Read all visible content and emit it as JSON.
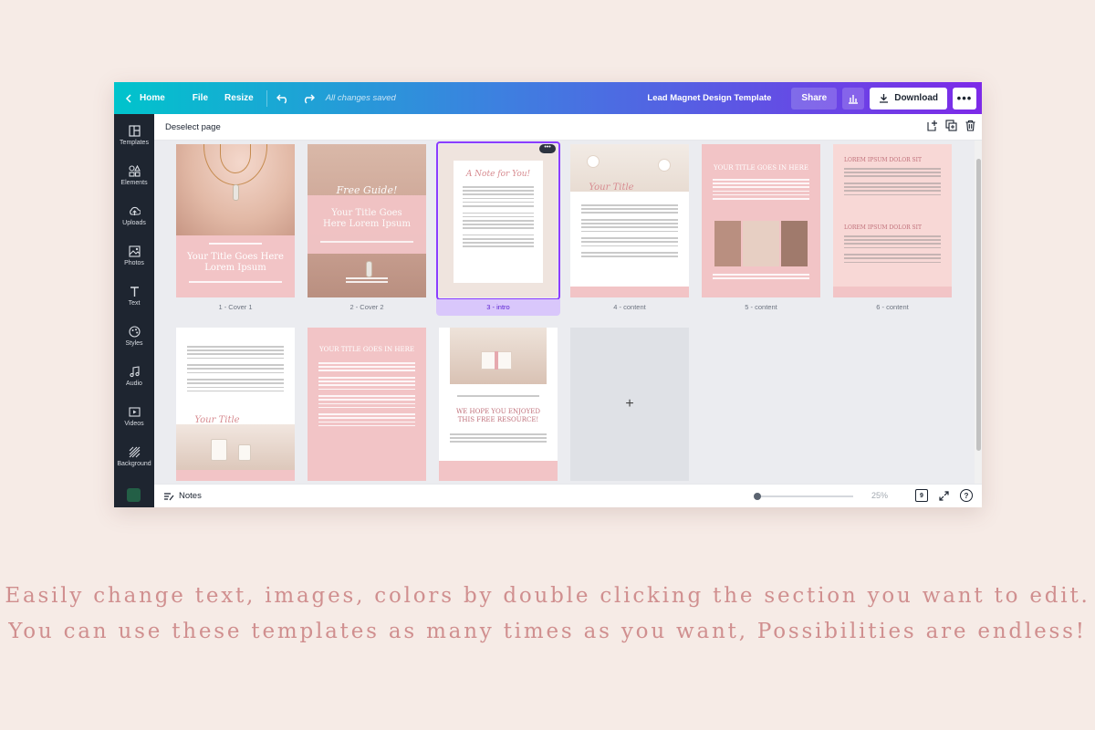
{
  "topbar": {
    "home": "Home",
    "file": "File",
    "resize": "Resize",
    "saved_status": "All changes saved",
    "doc_title": "Lead Magnet Design Template",
    "share": "Share",
    "download": "Download"
  },
  "sidebar": {
    "items": [
      {
        "label": "Templates",
        "icon": "templates-icon"
      },
      {
        "label": "Elements",
        "icon": "elements-icon"
      },
      {
        "label": "Uploads",
        "icon": "uploads-icon"
      },
      {
        "label": "Photos",
        "icon": "photos-icon"
      },
      {
        "label": "Text",
        "icon": "text-icon"
      },
      {
        "label": "Styles",
        "icon": "styles-icon"
      },
      {
        "label": "Audio",
        "icon": "audio-icon"
      },
      {
        "label": "Videos",
        "icon": "videos-icon"
      },
      {
        "label": "Background",
        "icon": "background-icon"
      }
    ]
  },
  "header": {
    "deselect": "Deselect page"
  },
  "pages": [
    {
      "label": "1 - Cover 1",
      "title": "Your Title Goes Here Lorem Ipsum"
    },
    {
      "label": "2 - Cover 2",
      "script": "Free Guide!",
      "title": "Your Title Goes Here Lorem Ipsum"
    },
    {
      "label": "3 - intro",
      "script": "A Note for You!"
    },
    {
      "label": "4 - content",
      "script": "Your Title"
    },
    {
      "label": "5 - content",
      "title": "YOUR TITLE GOES IN HERE"
    },
    {
      "label": "6 - content",
      "heading1": "LOREM IPSUM DOLOR SIT",
      "heading2": "LOREM IPSUM DOLOR SIT"
    },
    {
      "label": "",
      "script": "Your Title"
    },
    {
      "label": "",
      "title": "YOUR TITLE GOES IN HERE"
    },
    {
      "label": "",
      "title": "WE HOPE YOU ENJOYED THIS FREE RESOURCE!"
    }
  ],
  "add_page_symbol": "+",
  "footer": {
    "notes": "Notes",
    "zoom": "25%",
    "page_count": "9",
    "help": "?"
  },
  "tagline": {
    "line1": "Easily change text, images, colors by double clicking the section you want to edit.",
    "line2": "You can use these templates as many times as you want, Possibilities are endless!"
  },
  "colors": {
    "accent": "#8b3dff",
    "pink": "#f2c4c6",
    "tagline": "#d08f8f"
  }
}
